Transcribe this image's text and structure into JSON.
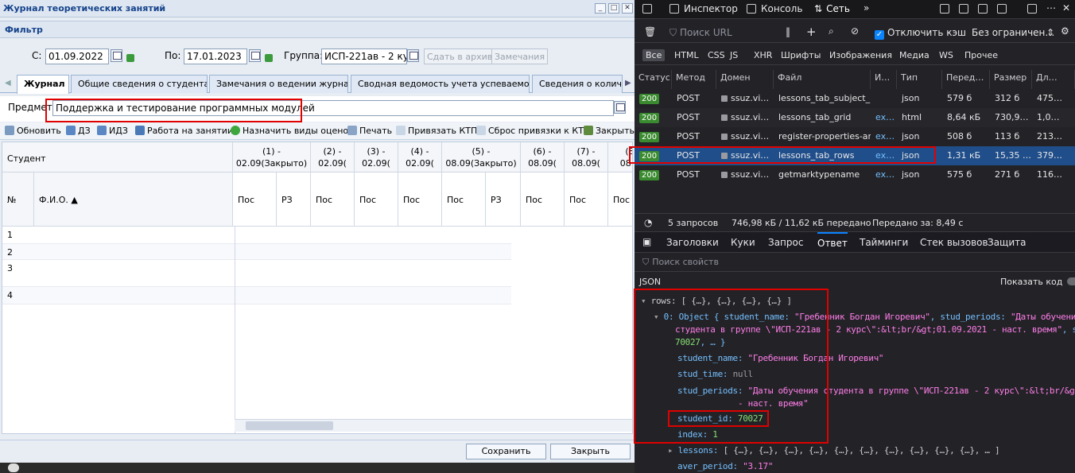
{
  "app": {
    "title": "Журнал теоретических занятий",
    "filter_title": "Фильтр",
    "from_label": "С:",
    "from_date": "01.09.2022",
    "to_label": "По:",
    "to_date": "17.01.2023",
    "group_label": "Группа:",
    "group_value": "ИСП-221ав - 2 кур",
    "archive_btn": "Сдать в архив",
    "notes_btn": "Замечания",
    "tabs": [
      "Журнал",
      "Общие сведения о студентах",
      "Замечания о ведении журнала",
      "Сводная ведомость учета успеваемости",
      "Сведения о количес"
    ],
    "subject_label": "Предмет:",
    "subject_value": "Поддержка и тестирование программных модулей",
    "toolbar": {
      "refresh": "Обновить",
      "dz": "ДЗ",
      "idz": "ИДЗ",
      "work": "Работа на занятии",
      "assign": "Назначить виды оценок",
      "print": "Печать",
      "bind": "Привязать КТП",
      "reset": "Сброс привязки к КТП",
      "close": "Закрыть"
    },
    "grid": {
      "student_header": "Студент",
      "num_header": "№",
      "fio_header": "Ф.И.О. ▲",
      "lessons": [
        {
          "l1": "(1) -",
          "l2": "02.09(Закрыто)"
        },
        {
          "l1": "(2) -",
          "l2": "02.09("
        },
        {
          "l1": "(3) -",
          "l2": "02.09("
        },
        {
          "l1": "(4) -",
          "l2": "02.09("
        },
        {
          "l1": "(5) -",
          "l2": "08.09(Закрыто)"
        },
        {
          "l1": "(6) -",
          "l2": "08.09("
        },
        {
          "l1": "(7) -",
          "l2": "08.09("
        },
        {
          "l1": "(8",
          "l2": "08.0"
        }
      ],
      "sub": [
        "Пос",
        "РЗ",
        "Пос",
        "Пос",
        "Пос",
        "Пос",
        "РЗ",
        "Пос",
        "Пос",
        "Пос"
      ],
      "rows": [
        "1",
        "2",
        "3",
        "4"
      ]
    },
    "save_btn": "Сохранить",
    "close_btn": "Закрыть"
  },
  "devtools": {
    "tabs": {
      "inspector": "Инспектор",
      "console": "Консоль",
      "network": "Сеть"
    },
    "filter_placeholder": "Поиск URL",
    "disable_cache": "Отключить кэш",
    "throttle": "Без ограничен…",
    "types": [
      "Все",
      "HTML",
      "CSS",
      "JS",
      "XHR",
      "Шрифты",
      "Изображения",
      "Медиа",
      "WS",
      "Прочее"
    ],
    "columns": [
      "Статус",
      "Метод",
      "Домен",
      "Файл",
      "И…",
      "Тип",
      "Перед…",
      "Размер",
      "Дл…"
    ],
    "requests": [
      {
        "status": "200",
        "method": "POST",
        "domain": "ssuz.vi…",
        "file": "lessons_tab_subject_ro",
        "init": "",
        "type": "json",
        "transferred": "579 б",
        "size": "312 б",
        "dur": "475…"
      },
      {
        "status": "200",
        "method": "POST",
        "domain": "ssuz.vi…",
        "file": "lessons_tab_grid",
        "init": "ex…",
        "type": "html",
        "transferred": "8,64 кБ",
        "size": "730,9…",
        "dur": "1,0…"
      },
      {
        "status": "200",
        "method": "POST",
        "domain": "ssuz.vi…",
        "file": "register-properties-arch",
        "init": "ex…",
        "type": "json",
        "transferred": "508 б",
        "size": "113 б",
        "dur": "213…"
      },
      {
        "status": "200",
        "method": "POST",
        "domain": "ssuz.vi…",
        "file": "lessons_tab_rows",
        "init": "ex…",
        "type": "json",
        "transferred": "1,31 кБ",
        "size": "15,35 …",
        "dur": "379…"
      },
      {
        "status": "200",
        "method": "POST",
        "domain": "ssuz.vi…",
        "file": "getmarktypename",
        "init": "ex…",
        "type": "json",
        "transferred": "575 б",
        "size": "271 б",
        "dur": "116…"
      }
    ],
    "summary": {
      "requests": "5 запросов",
      "transferred": "746,98 кБ / 11,62 кБ передано",
      "finish": "Передано за: 8,49 с"
    },
    "detail_tabs": [
      "Заголовки",
      "Куки",
      "Запрос",
      "Ответ",
      "Тайминги",
      "Стек вызовов",
      "Защита"
    ],
    "props_placeholder": "Поиск свойств",
    "json_label": "JSON",
    "show_code": "Показать код",
    "json": {
      "rows_line": "rows: [ {…}, {…}, {…}, {…} ]",
      "obj_line_a": "0: Object { student_name: ",
      "obj_name": "\"Гребенник Богдан Игоревич\"",
      "obj_mid": ", stud_periods: ",
      "obj_per_a": "\"Даты обучения",
      "obj_per_b": "студента в группе \\\"ИСП-221ав - 2 курс\\\":&lt;br/&gt;01.09.2021 - наст. время\"",
      "obj_tail": ", student_id:",
      "obj_id": "70027",
      "obj_end": ", … }",
      "k_student_name": "student_name:",
      "v_student_name": "\"Гребенник Богдан Игоревич\"",
      "k_stud_time": "stud_time:",
      "v_stud_time": "null",
      "k_stud_periods": "stud_periods:",
      "v_stud_periods_a": "\"Даты обучения студента в группе \\\"ИСП-221ав - 2 курс\\\":&lt;br/&gt;01.09.2021",
      "v_stud_periods_b": "- наст. время\"",
      "k_student_id": "student_id:",
      "v_student_id": "70027",
      "k_index": "index:",
      "v_index": "1",
      "k_lessons": "lessons:",
      "v_lessons": "[ {…}, {…}, {…}, {…}, {…}, {…}, {…}, {…}, {…}, {…}, … ]",
      "k_aver": "aver_period:",
      "v_aver": "\"3.17\""
    }
  }
}
